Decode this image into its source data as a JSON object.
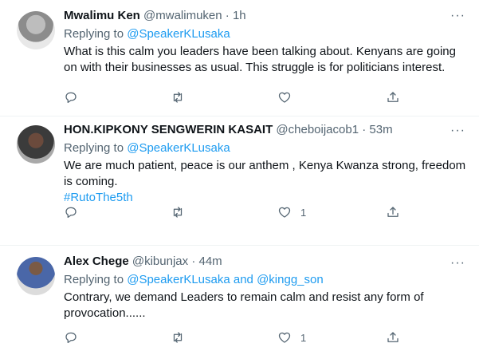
{
  "tweets": [
    {
      "name": "Mwalimu Ken",
      "handle": "@mwalimuken",
      "time": "1h",
      "replying_label": "Replying to ",
      "replying_to": "@SpeakerKLusaka",
      "replying_and": "",
      "replying_to_2": "",
      "text": "What is this calm you leaders have been talking about. Kenyans are going on with their businesses as usual. This struggle is for politicians interest.",
      "hashtag": "",
      "like_count": ""
    },
    {
      "name": "HON.KIPKONY SENGWERIN KASAIT",
      "handle": "@cheboijacob1",
      "time": "53m",
      "replying_label": "Replying to ",
      "replying_to": "@SpeakerKLusaka",
      "replying_and": "",
      "replying_to_2": "",
      "text": "We are much patient, peace is our anthem , Kenya Kwanza strong, freedom is coming.",
      "hashtag": "#RutoThe5th",
      "like_count": "1"
    },
    {
      "name": "Alex Chege",
      "handle": "@kibunjax",
      "time": "44m",
      "replying_label": "Replying to ",
      "replying_to": "@SpeakerKLusaka",
      "replying_and": " and ",
      "replying_to_2": "@kingg_son",
      "text": "Contrary, we demand Leaders to remain calm and resist any form of provocation......",
      "hashtag": "",
      "like_count": "1"
    }
  ],
  "icons": {
    "more": "more-dots-icon",
    "reply": "reply-icon",
    "retweet": "retweet-icon",
    "like": "heart-icon",
    "share": "share-icon"
  },
  "colors": {
    "accent": "#1d9bf0",
    "muted": "#536471",
    "text": "#0f1419",
    "divider": "#eff3f4"
  }
}
